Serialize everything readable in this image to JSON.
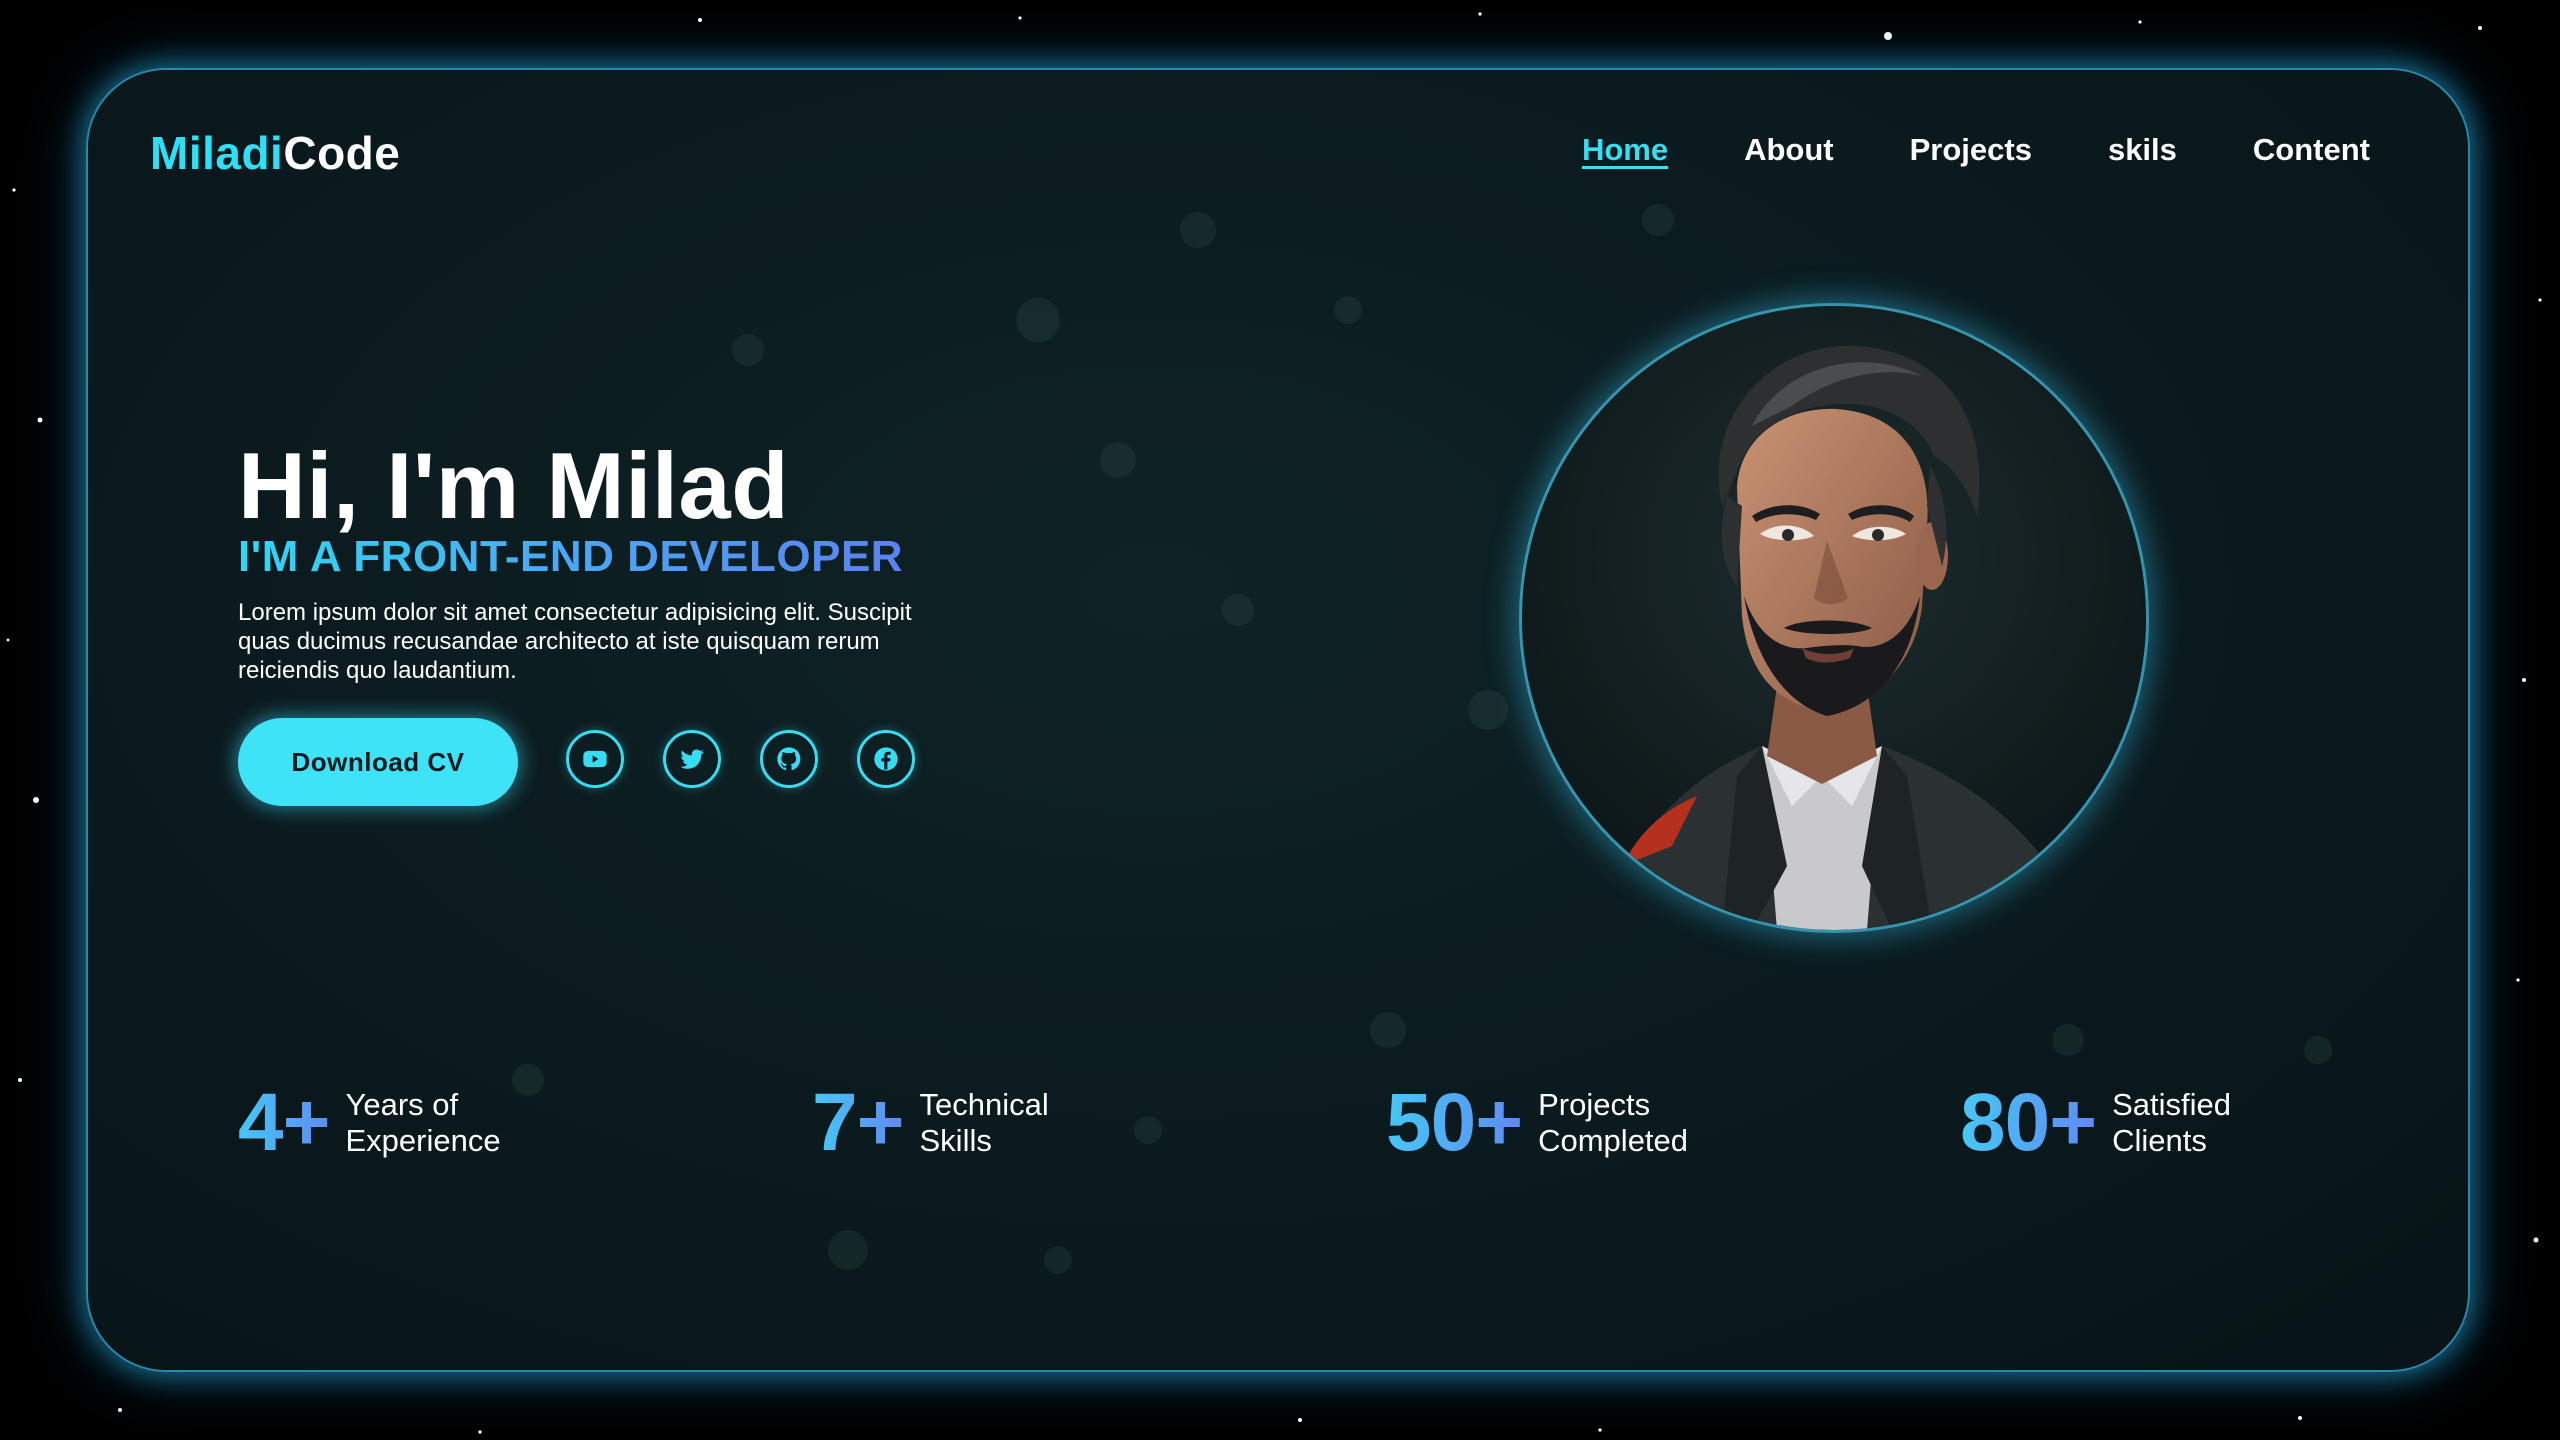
{
  "logo": {
    "part1": "Miladi",
    "part2": "Code"
  },
  "nav": [
    {
      "label": "Home",
      "active": true
    },
    {
      "label": "About"
    },
    {
      "label": "Projects"
    },
    {
      "label": "skils"
    },
    {
      "label": "Content"
    }
  ],
  "hero": {
    "name": "Hi, I'm Milad",
    "role": "I'M A FRONT-END DEVELOPER",
    "description": "Lorem ipsum dolor sit amet consectetur adipisicing elit. Suscipit quas ducimus recusandae architecto at iste quisquam rerum reiciendis quo laudantium.",
    "cv_button": "Download CV"
  },
  "social": [
    {
      "icon": "youtube-icon"
    },
    {
      "icon": "twitter-icon"
    },
    {
      "icon": "github-icon"
    },
    {
      "icon": "facebook-icon"
    }
  ],
  "stats": [
    {
      "value": "4+",
      "line1": "Years of",
      "line2": "Experience"
    },
    {
      "value": "7+",
      "line1": "Technical",
      "line2": "Skills"
    },
    {
      "value": "50+",
      "line1": "Projects",
      "line2": "Completed"
    },
    {
      "value": "80+",
      "line1": "Satisfied",
      "line2": "Clients"
    }
  ],
  "colors": {
    "accent": "#2ee0f5",
    "card_bg": "#0b1b1f",
    "glow": "#28aadc"
  }
}
